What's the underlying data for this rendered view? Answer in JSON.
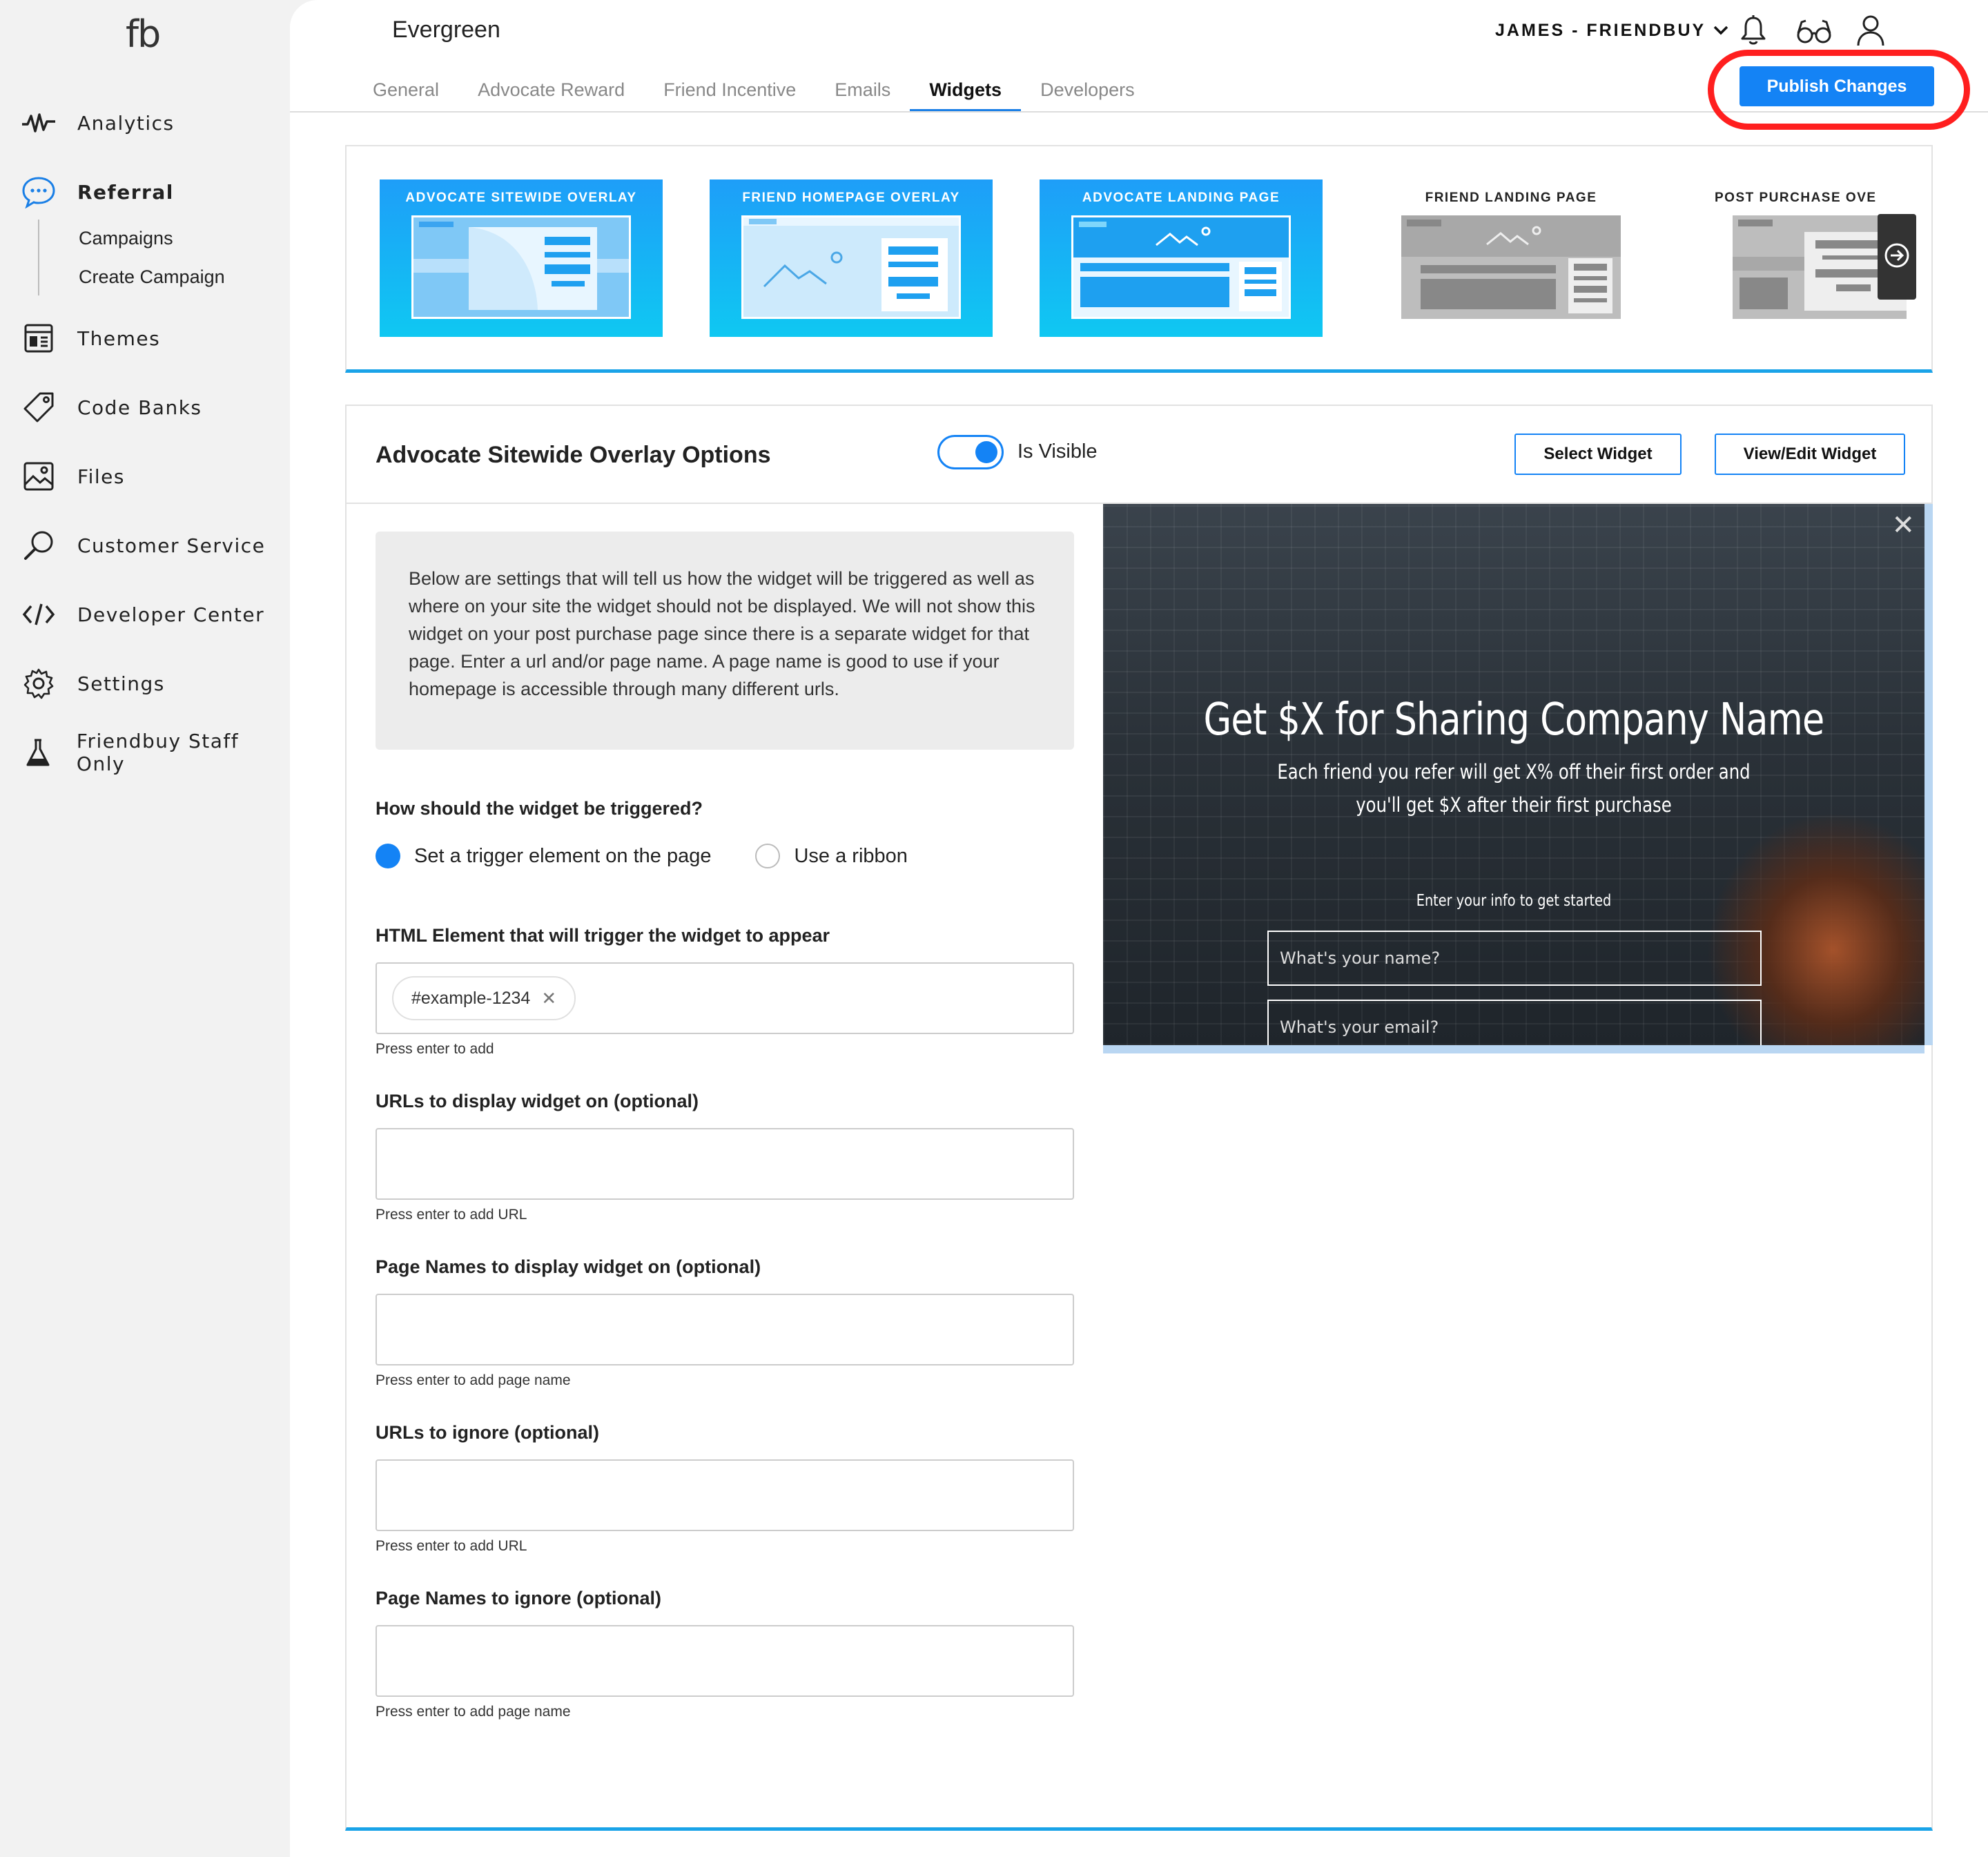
{
  "sidebar": {
    "logo": "fb",
    "items": [
      {
        "label": "Analytics",
        "icon": "analytics-icon"
      },
      {
        "label": "Referral",
        "icon": "referral-chat-icon",
        "active": true
      },
      {
        "label": "Themes",
        "icon": "themes-icon"
      },
      {
        "label": "Code Banks",
        "icon": "tag-icon"
      },
      {
        "label": "Files",
        "icon": "image-file-icon"
      },
      {
        "label": "Customer Service",
        "icon": "search-icon"
      },
      {
        "label": "Developer Center",
        "icon": "code-icon"
      },
      {
        "label": "Settings",
        "icon": "gear-icon"
      },
      {
        "label": "Friendbuy Staff Only",
        "icon": "flask-icon"
      }
    ],
    "referral_subitems": [
      "Campaigns",
      "Create Campaign"
    ]
  },
  "header": {
    "campaign_title": "Evergreen",
    "account_label": "JAMES - FRIENDBUY",
    "icons": [
      "bell-icon",
      "glasses-icon",
      "user-icon"
    ],
    "publish_label": "Publish Changes"
  },
  "tabs": [
    {
      "label": "General"
    },
    {
      "label": "Advocate Reward"
    },
    {
      "label": "Friend Incentive"
    },
    {
      "label": "Emails"
    },
    {
      "label": "Widgets",
      "active": true
    },
    {
      "label": "Developers"
    }
  ],
  "widget_strip": [
    {
      "label": "ADVOCATE SITEWIDE OVERLAY",
      "style": "blue"
    },
    {
      "label": "FRIEND HOMEPAGE OVERLAY",
      "style": "blue"
    },
    {
      "label": "ADVOCATE LANDING PAGE",
      "style": "blue"
    },
    {
      "label": "FRIEND LANDING PAGE",
      "style": "grey"
    },
    {
      "label": "POST PURCHASE OVE",
      "style": "grey"
    }
  ],
  "options": {
    "title": "Advocate Sitewide Overlay Options",
    "visible_label": "Is Visible",
    "select_widget": "Select Widget",
    "view_edit_widget": "View/Edit Widget",
    "info_text": "Below are settings that will tell us how the widget will be triggered as well as where on your site the widget should not be displayed. We will not show this widget on your post purchase page since there is a separate widget for that page. Enter a url and/or page name. A page name is good to use if your homepage is accessible through many different urls.",
    "trigger_question": "How should the widget be triggered?",
    "trigger_options": [
      "Set a trigger element on the page",
      "Use a ribbon"
    ],
    "trigger_selected": 0,
    "html_element_label": "HTML Element that will trigger the widget to appear",
    "html_element_chip": "#example-1234",
    "html_element_hint": "Press enter to add",
    "urls_display_label": "URLs to display widget on (optional)",
    "urls_display_hint": "Press enter to add URL",
    "pages_display_label": "Page Names to display widget on (optional)",
    "pages_display_hint": "Press enter to add page name",
    "urls_ignore_label": "URLs to ignore (optional)",
    "urls_ignore_hint": "Press enter to add URL",
    "pages_ignore_label": "Page Names to ignore (optional)",
    "pages_ignore_hint": "Press enter to add page name"
  },
  "preview": {
    "headline": "Get $X for Sharing Company Name",
    "subtext": "Each friend you refer will get X% off their first order and you'll get $X after their first purchase",
    "cta": "Enter your info to get started",
    "name_placeholder": "What's your name?",
    "email_placeholder": "What's your email?"
  },
  "colors": {
    "accent": "#1483f5",
    "highlight": "#ff1f1f",
    "panel_rule": "#1aa3e8"
  }
}
